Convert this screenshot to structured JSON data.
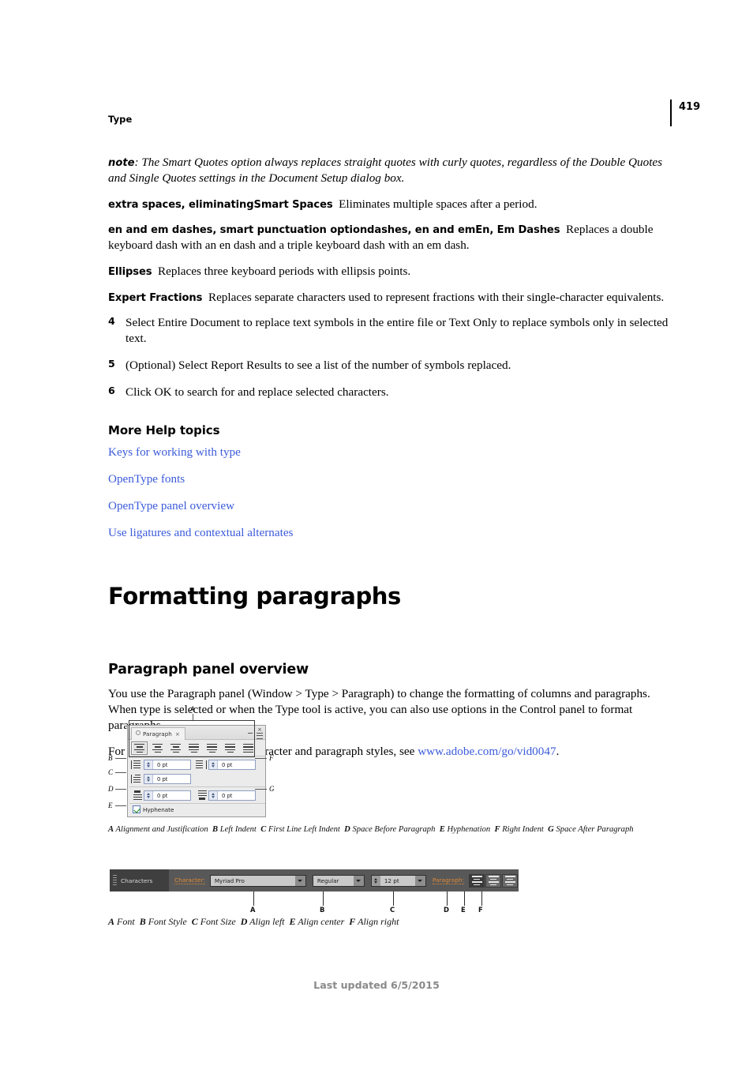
{
  "header": {
    "running_head": "Type",
    "page_number": "419"
  },
  "body": {
    "note_lead": "note",
    "note_text": ": The Smart Quotes option always replaces straight quotes with curly quotes, regardless of the Double Quotes and Single Quotes settings in the Document Setup dialog box.",
    "defs": [
      {
        "term": "extra spaces, eliminatingSmart Spaces",
        "desc": "Eliminates multiple spaces after a period."
      },
      {
        "term": "en and em dashes, smart punctuation optiondashes, en and emEn, Em Dashes",
        "desc": "Replaces a double keyboard dash with an en dash and a triple keyboard dash with an em dash."
      },
      {
        "term": "Ellipses",
        "desc": "Replaces three keyboard periods with ellipsis points."
      },
      {
        "term": "Expert Fractions",
        "desc": "Replaces separate characters used to represent fractions with their single-character equivalents."
      }
    ],
    "steps": [
      {
        "num": "4",
        "text": "Select Entire Document to replace text symbols in the entire file or Text Only to replace symbols only in selected text."
      },
      {
        "num": "5",
        "text": "(Optional) Select Report Results to see a list of the number of symbols replaced."
      },
      {
        "num": "6",
        "text": "Click OK to search for and replace selected characters."
      }
    ]
  },
  "more_help": {
    "title": "More Help topics",
    "links": [
      "Keys for working with type",
      "OpenType fonts",
      "OpenType panel overview",
      "Use ligatures and contextual alternates"
    ]
  },
  "chapter": {
    "title": "Formatting paragraphs"
  },
  "section": {
    "title": "Paragraph panel overview",
    "para1": "You use the Paragraph panel (Window > Type > Paragraph) to change the formatting of columns and paragraphs. When type is selected or when the Type tool is active, you can also use options in the Control panel to format paragraphs.",
    "para2_before": "For a video on working with character and paragraph styles, see ",
    "para2_link": "www.adobe.com/go/vid0047",
    "para2_after": "."
  },
  "figure1": {
    "panel_tab": "Paragraph",
    "close_glyph": "×",
    "tab_close_glyph": "×",
    "fields": {
      "left_indent": "0 pt",
      "right_indent": "0 pt",
      "first_line_left_indent": "0 pt",
      "space_before": "0 pt",
      "space_after": "0 pt"
    },
    "hyphenate_label": "Hyphenate",
    "callouts": {
      "a": "A",
      "b": "B",
      "c": "C",
      "d": "D",
      "e": "E",
      "f": "F",
      "g": "G"
    },
    "caption_items": [
      {
        "letter": "A",
        "label": "Alignment and Justification"
      },
      {
        "letter": "B",
        "label": "Left Indent"
      },
      {
        "letter": "C",
        "label": "First Line Left Indent"
      },
      {
        "letter": "D",
        "label": "Space Before Paragraph"
      },
      {
        "letter": "E",
        "label": "Hyphenation"
      },
      {
        "letter": "F",
        "label": "Right Indent"
      },
      {
        "letter": "G",
        "label": "Space After Paragraph"
      }
    ]
  },
  "figure2": {
    "dock_label": "Characters",
    "character_label": "Character:",
    "paragraph_label": "Paragraph:",
    "font": "Myriad Pro",
    "font_style": "Regular",
    "font_size": "12 pt",
    "callouts": {
      "a": "A",
      "b": "B",
      "c": "C",
      "d": "D",
      "e": "E",
      "f": "F"
    },
    "caption_items": [
      {
        "letter": "A",
        "label": "Font"
      },
      {
        "letter": "B",
        "label": "Font Style"
      },
      {
        "letter": "C",
        "label": "Font Size"
      },
      {
        "letter": "D",
        "label": "Align left"
      },
      {
        "letter": "E",
        "label": "Align center"
      },
      {
        "letter": "F",
        "label": "Align right"
      }
    ]
  },
  "footer": {
    "text": "Last updated 6/5/2015"
  },
  "colors": {
    "link": "#3b5bdb",
    "orange_label": "#e08a35",
    "panel_bg": "#ebebeb",
    "ctrl_bg": "#585858",
    "footer_text": "#8a8a8a"
  }
}
